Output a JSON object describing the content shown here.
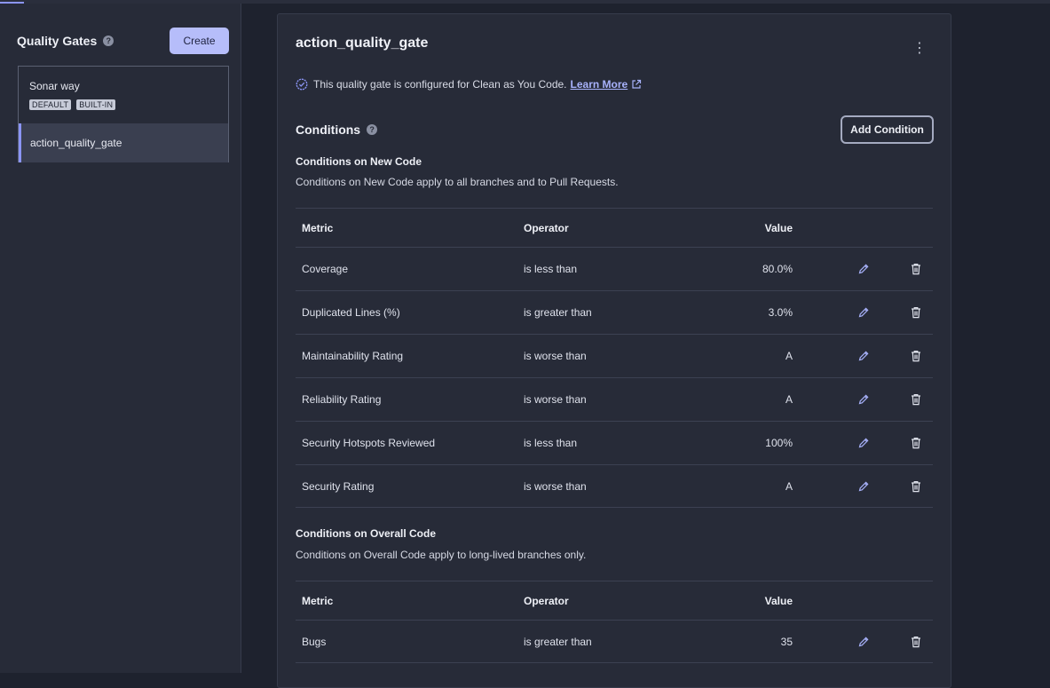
{
  "sidebar": {
    "title": "Quality Gates",
    "help": "?",
    "create_label": "Create",
    "gates": [
      {
        "name": "Sonar way",
        "badges": [
          "DEFAULT",
          "BUILT-IN"
        ]
      },
      {
        "name": "action_quality_gate",
        "selected": true
      }
    ]
  },
  "gate": {
    "title": "action_quality_gate",
    "menu": "⋮",
    "cayc_text": "This quality gate is configured for Clean as You Code.",
    "learn_more": "Learn More",
    "conditions_title": "Conditions",
    "help": "?",
    "add_condition": "Add Condition",
    "new_code": {
      "title": "Conditions on New Code",
      "description": "Conditions on New Code apply to all branches and to Pull Requests.",
      "columns": {
        "metric": "Metric",
        "operator": "Operator",
        "value": "Value"
      },
      "rows": [
        {
          "metric": "Coverage",
          "operator": "is less than",
          "value": "80.0%"
        },
        {
          "metric": "Duplicated Lines (%)",
          "operator": "is greater than",
          "value": "3.0%"
        },
        {
          "metric": "Maintainability Rating",
          "operator": "is worse than",
          "value": "A"
        },
        {
          "metric": "Reliability Rating",
          "operator": "is worse than",
          "value": "A"
        },
        {
          "metric": "Security Hotspots Reviewed",
          "operator": "is less than",
          "value": "100%"
        },
        {
          "metric": "Security Rating",
          "operator": "is worse than",
          "value": "A"
        }
      ]
    },
    "overall_code": {
      "title": "Conditions on Overall Code",
      "description": "Conditions on Overall Code apply to long-lived branches only.",
      "columns": {
        "metric": "Metric",
        "operator": "Operator",
        "value": "Value"
      },
      "rows": [
        {
          "metric": "Bugs",
          "operator": "is greater than",
          "value": "35"
        }
      ]
    }
  },
  "colors": {
    "accent": "#8b95f5",
    "link": "#a8b2fb",
    "background": "#1e222e",
    "panel": "#272b38"
  }
}
